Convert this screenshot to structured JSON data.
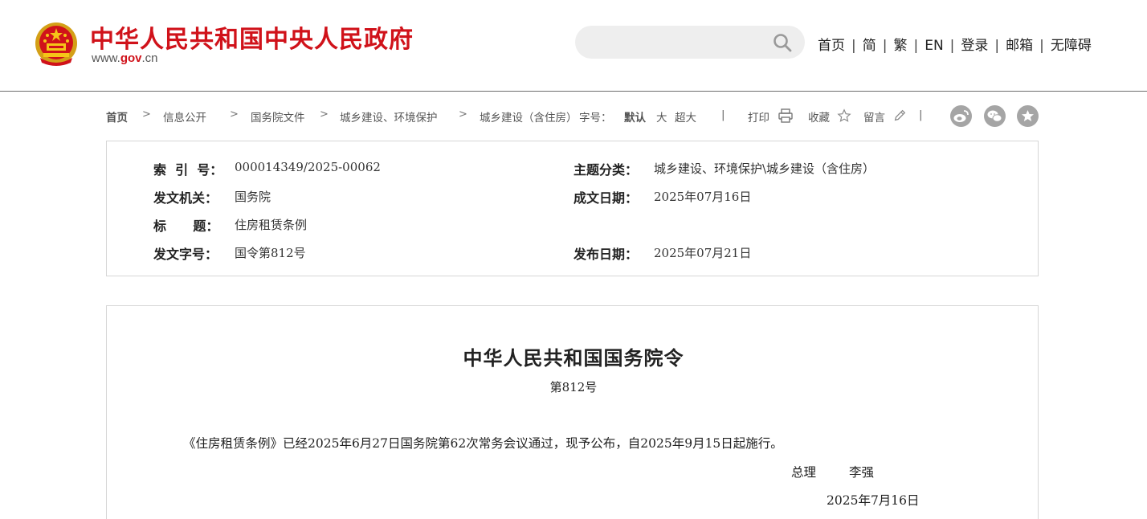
{
  "header": {
    "site_title": "中华人民共和国中央人民政府",
    "site_url_prefix": "www.",
    "site_url_domain": "gov",
    "site_url_suffix": ".cn",
    "search_placeholder": "",
    "nav": [
      "首页",
      "简",
      "繁",
      "EN",
      "登录",
      "邮箱",
      "无障碍"
    ],
    "nav_separator": "|"
  },
  "breadcrumb": {
    "home": "首页",
    "items": [
      "信息公开",
      "国务院文件",
      "城乡建设、环境保护",
      "城乡建设（含住房）"
    ],
    "arrow": ">",
    "font_size_label": "字号：",
    "font_size_default": "默认",
    "font_size_large": "大",
    "font_size_xlarge": "超大",
    "divider": "|",
    "print_label": "打印",
    "favorite_label": "收藏",
    "comment_label": "留言"
  },
  "info": {
    "index_label": "索  引  号：",
    "index_value": "000014349/2025-00062",
    "topic_label": "主题分类：",
    "topic_value": "城乡建设、环境保护\\城乡建设（含住房）",
    "issuer_label": "发文机关：",
    "issuer_value": "国务院",
    "written_date_label": "成文日期：",
    "written_date_value": "2025年07月16日",
    "title_label": "标      题：",
    "title_value": "住房租赁条例",
    "doc_no_label": "发文字号：",
    "doc_no_value": "国令第812号",
    "publish_date_label": "发布日期：",
    "publish_date_value": "2025年07月21日"
  },
  "document": {
    "title": "中华人民共和国国务院令",
    "number": "第812号",
    "paragraph": "《住房租赁条例》已经2025年6月27日国务院第62次常务会议通过，现予公布，自2025年9月15日起施行。",
    "sign_role": "总理",
    "sign_name": "李强",
    "sign_date": "2025年7月16日"
  },
  "colors": {
    "brand_red": "#d0121a",
    "accent_blue": "#245a9a",
    "social_gray": "#a5a5a5"
  },
  "icons": [
    "national-emblem-icon",
    "search-icon",
    "printer-icon",
    "star-icon",
    "pencil-icon",
    "weibo-icon",
    "wechat-icon",
    "favorite-star-icon"
  ]
}
